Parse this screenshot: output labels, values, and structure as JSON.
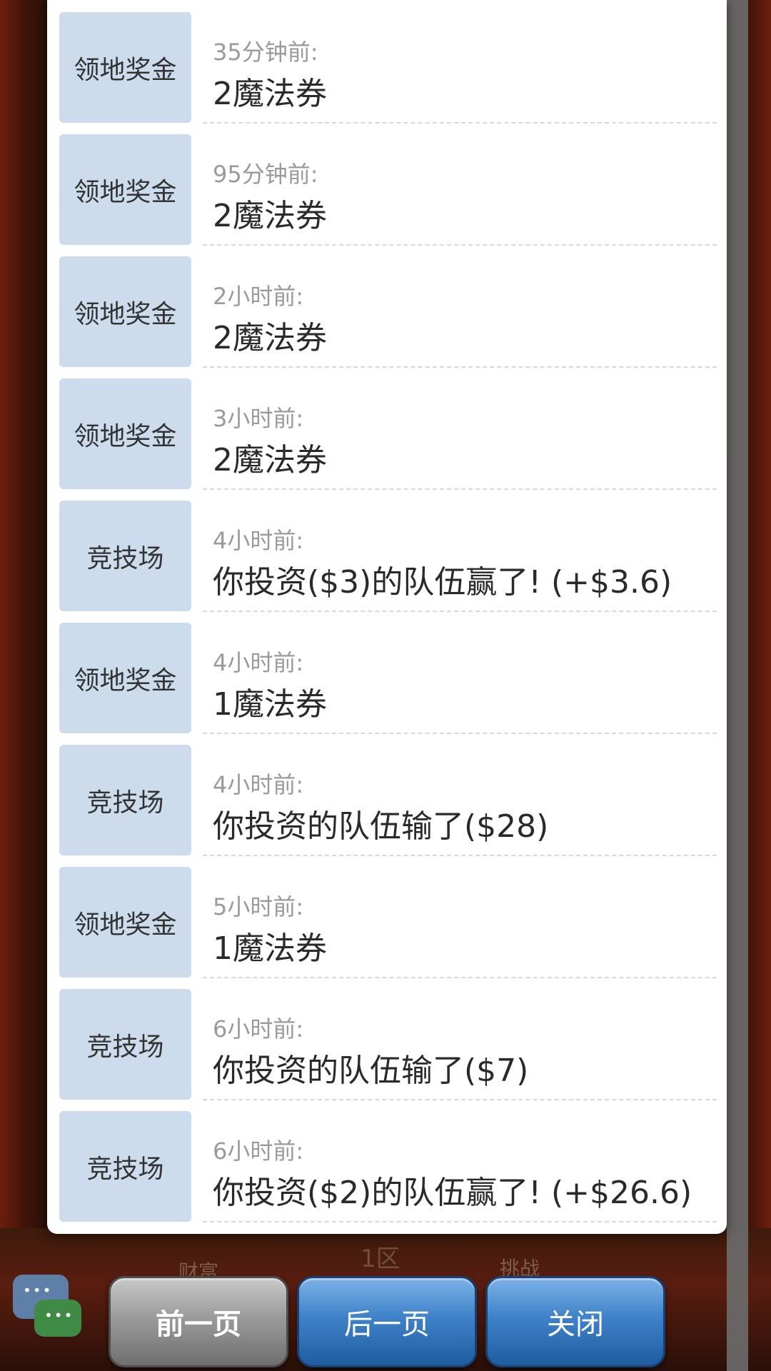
{
  "background": {
    "zone_label": "1区",
    "left_faded_label": "财富",
    "right_faded_label": "挑战"
  },
  "records": [
    {
      "tag": "领地奖金",
      "time": "35分钟前:",
      "text": "2魔法券"
    },
    {
      "tag": "领地奖金",
      "time": "95分钟前:",
      "text": "2魔法券"
    },
    {
      "tag": "领地奖金",
      "time": "2小时前:",
      "text": "2魔法券"
    },
    {
      "tag": "领地奖金",
      "time": "3小时前:",
      "text": "2魔法券"
    },
    {
      "tag": "竞技场",
      "time": "4小时前:",
      "text": "你投资($3)的队伍赢了! (+$3.6)"
    },
    {
      "tag": "领地奖金",
      "time": "4小时前:",
      "text": "1魔法券"
    },
    {
      "tag": "竞技场",
      "time": "4小时前:",
      "text": "你投资的队伍输了($28)"
    },
    {
      "tag": "领地奖金",
      "time": "5小时前:",
      "text": "1魔法券"
    },
    {
      "tag": "竞技场",
      "time": "6小时前:",
      "text": "你投资的队伍输了($7)"
    },
    {
      "tag": "竞技场",
      "time": "6小时前:",
      "text": "你投资($2)的队伍赢了! (+$26.6)"
    }
  ],
  "buttons": {
    "prev": "前一页",
    "next": "后一页",
    "close": "关闭"
  },
  "colors": {
    "tag_bg": "#ccdcec",
    "prev_button": "#9b9b9b",
    "blue_button": "#3f82c9"
  }
}
